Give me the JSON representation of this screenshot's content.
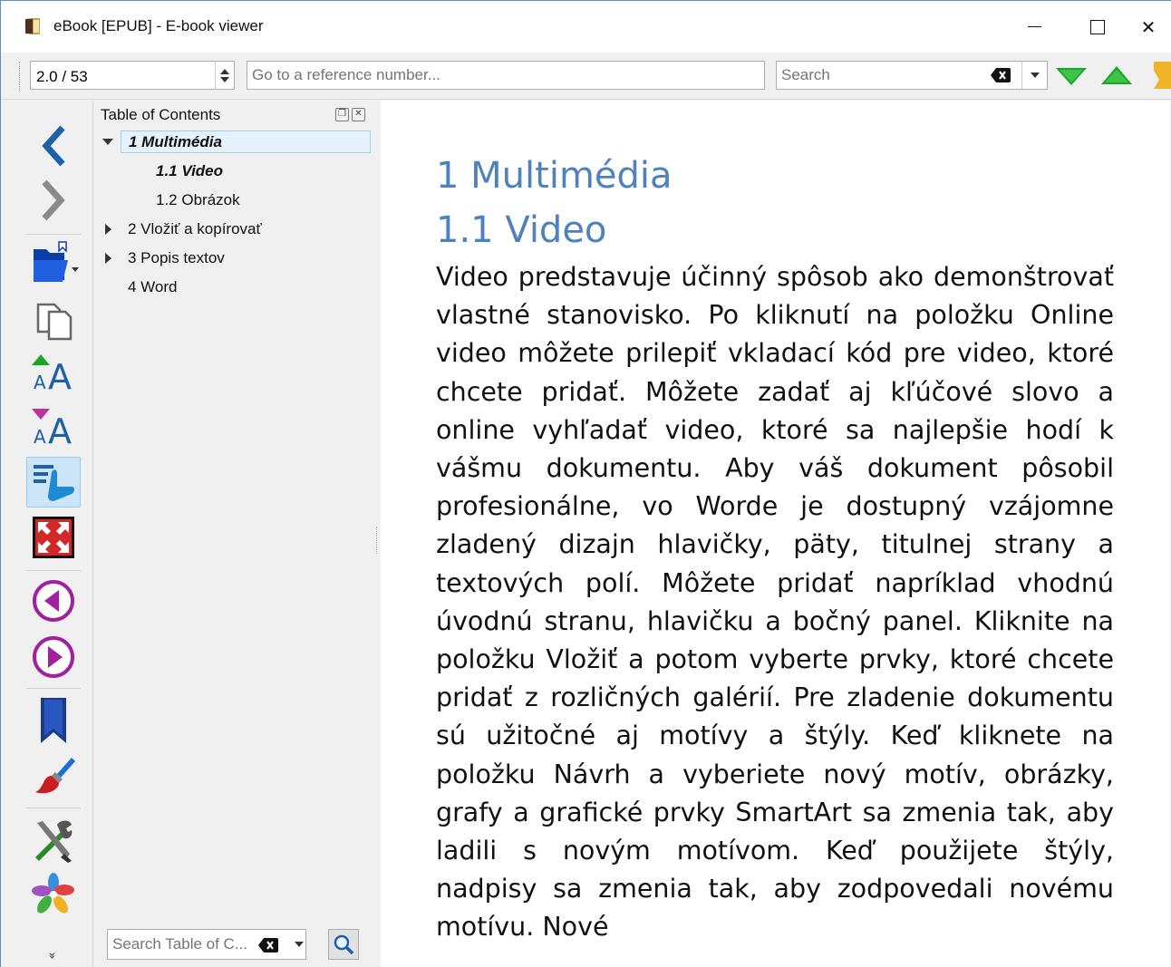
{
  "window": {
    "title": "eBook [EPUB] - E-book viewer",
    "close_glyph": "✕"
  },
  "toolbar": {
    "page_position": "2.0 / 53",
    "reference_placeholder": "Go to a reference number...",
    "search_placeholder": "Search"
  },
  "toc": {
    "title": "Table of Contents",
    "items": [
      {
        "label": "1 Multimédia",
        "level": 0,
        "expanded": true,
        "selected": true
      },
      {
        "label": "1.1 Video",
        "level": 1,
        "current": true
      },
      {
        "label": "1.2 Obrázok",
        "level": 1
      },
      {
        "label": "2 Vložiť a kopírovať",
        "level": 0,
        "expanded": false
      },
      {
        "label": "3 Popis textov",
        "level": 0,
        "expanded": false
      },
      {
        "label": "4 Word",
        "level": 0
      }
    ],
    "search_placeholder": "Search Table of C..."
  },
  "sidebar": {
    "more_glyph": "»"
  },
  "content": {
    "heading1": "1 Multimédia",
    "heading2": "1.1 Video",
    "paragraph": "Video predstavuje účinný spôsob ako demonštrovať vlastné stanovisko. Po kliknutí na položku Online video môžete prilepiť vkladací kód pre video, ktoré chcete pridať. Môžete zadať aj kľúčové slovo a online vyhľadať video, ktoré sa najlepšie hodí k vášmu dokumentu. Aby váš dokument pôsobil profesionálne, vo Worde je dostupný vzájomne zladený dizajn hlavičky, päty, titulnej strany a textových polí. Môžete pridať napríklad vhodnú úvodnú stranu, hlavičku a bočný panel. Kliknite na položku Vložiť a potom vyberte prvky, ktoré chcete pridať z rozličných galérií. Pre zladenie dokumentu sú užitočné aj motívy a štýly. Keď kliknete na položku Návrh a vyberiete nový motív, obrázky, grafy a grafické prvky SmartArt sa zmenia tak, aby ladili s novým motívom. Keď použijete štýly, nadpisy sa zmenia tak, aby zodpovedali novému motívu. Nové"
  },
  "colors": {
    "heading": "#4f81bd",
    "accent_blue": "#1e5fa8",
    "nav_green": "#2aa52a",
    "selection_bg": "#e5f1fb"
  }
}
